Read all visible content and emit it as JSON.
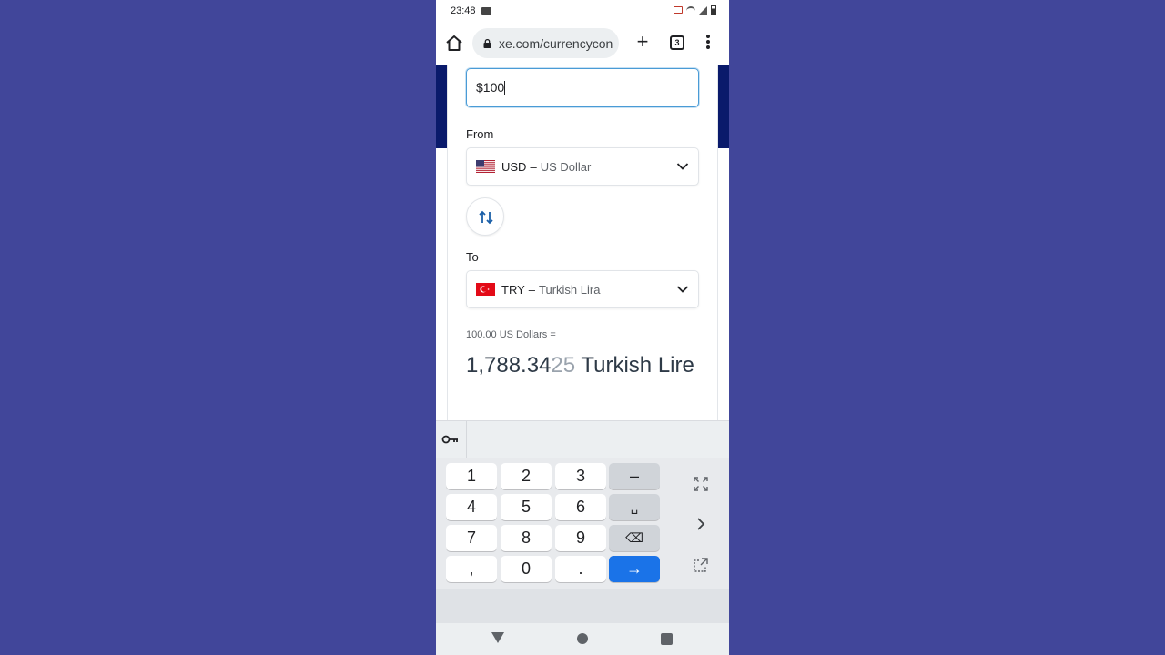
{
  "status_bar": {
    "time": "23:48"
  },
  "browser": {
    "url": "xe.com/currencycon",
    "tab_count": "3",
    "new_tab_label": "+"
  },
  "converter": {
    "amount_value": "$100",
    "from_label": "From",
    "from": {
      "code": "USD",
      "dash": "–",
      "name": "US Dollar"
    },
    "to_label": "To",
    "to": {
      "code": "TRY",
      "dash": "–",
      "name": "Turkish Lira"
    },
    "result_sub": "100.00 US Dollars =",
    "result_main": "1,788.34",
    "result_faded": "25",
    "result_unit": " Turkish Lire"
  },
  "keyboard": {
    "keys": [
      "1",
      "2",
      "3",
      "–",
      "4",
      "5",
      "6",
      "␣",
      "7",
      "8",
      "9",
      "⌫",
      ",",
      "0",
      ".",
      "→"
    ]
  }
}
